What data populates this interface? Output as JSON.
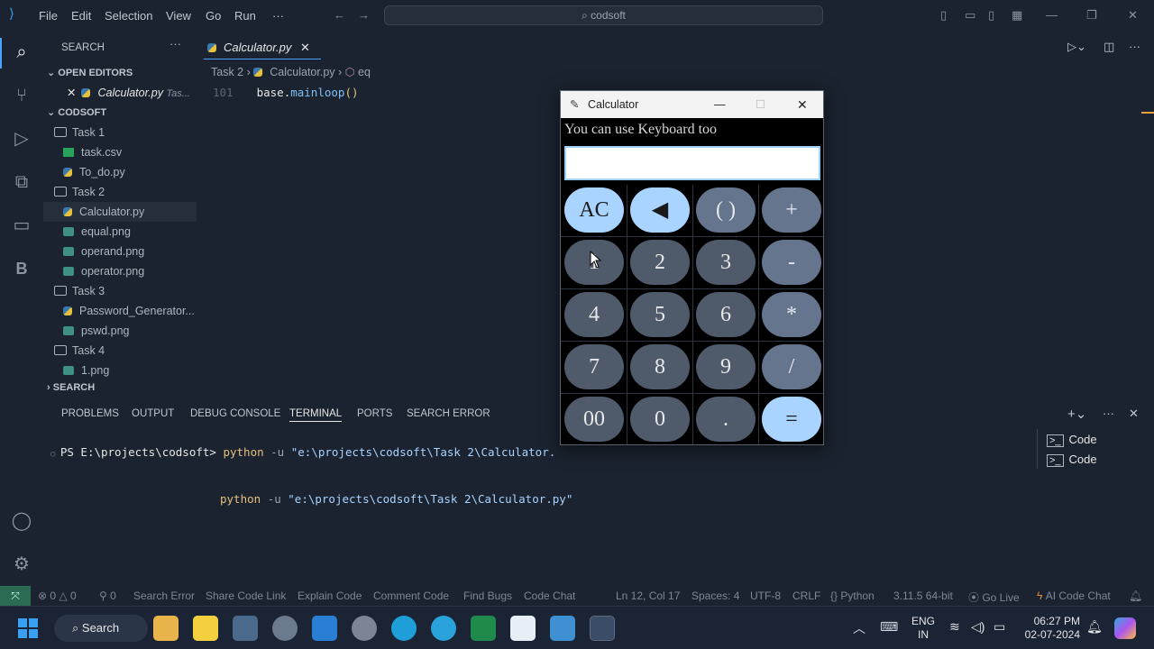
{
  "menu": {
    "file": "File",
    "edit": "Edit",
    "selection": "Selection",
    "view": "View",
    "go": "Go",
    "run": "Run",
    "more": "···"
  },
  "search_box": "codsoft",
  "sidebar": {
    "header": "SEARCH",
    "open_editors_label": "OPEN EDITORS",
    "open_editor_file": "Calculator.py",
    "open_editor_folder": "Tas...",
    "project_label": "CODSOFT",
    "items": [
      {
        "label": "Task 1",
        "kind": "folder"
      },
      {
        "label": "task.csv",
        "kind": "csv"
      },
      {
        "label": "To_do.py",
        "kind": "py"
      },
      {
        "label": "Task 2",
        "kind": "folder"
      },
      {
        "label": "Calculator.py",
        "kind": "py"
      },
      {
        "label": "equal.png",
        "kind": "png"
      },
      {
        "label": "operand.png",
        "kind": "png"
      },
      {
        "label": "operator.png",
        "kind": "png"
      },
      {
        "label": "Task 3",
        "kind": "folder"
      },
      {
        "label": "Password_Generator...",
        "kind": "py"
      },
      {
        "label": "pswd.png",
        "kind": "png"
      },
      {
        "label": "Task 4",
        "kind": "folder"
      },
      {
        "label": "1.png",
        "kind": "png"
      }
    ],
    "search_section": "SEARCH"
  },
  "editor": {
    "tab_label": "Calculator.py",
    "breadcrumb": {
      "folder": "Task 2",
      "file": "Calculator.py",
      "symbol": "eq"
    },
    "line_number": "101",
    "code_obj": "base",
    "code_method": "mainloop",
    "code_parens": "()"
  },
  "panel": {
    "tabs": [
      "PROBLEMS",
      "OUTPUT",
      "DEBUG CONSOLE",
      "TERMINAL",
      "PORTS",
      "SEARCH ERROR"
    ],
    "terminal_prompt": "PS E:\\projects\\codsoft>",
    "cmd_python": "python",
    "cmd_flag": "-u",
    "cmd_arg1": "\"e:\\projects\\codsoft\\Task 2\\Calculator.",
    "cmd_arg2": "\"e:\\projects\\codsoft\\Task 2\\Calculator.py\"",
    "terminals": [
      "Code",
      "Code"
    ]
  },
  "calculator": {
    "title": "Calculator",
    "hint": "You can use Keyboard too",
    "display_value": "",
    "rows": [
      [
        "AC",
        "◀",
        "( )",
        "+"
      ],
      [
        "1",
        "2",
        "3",
        "-"
      ],
      [
        "4",
        "5",
        "6",
        "*"
      ],
      [
        "7",
        "8",
        "9",
        "/"
      ],
      [
        "00",
        "0",
        ".",
        "="
      ]
    ]
  },
  "statusbar": {
    "errors": "0",
    "warnings": "0",
    "ports": "0",
    "search_error": "Search Error",
    "share_code_link": "Share Code Link",
    "explain_code": "Explain Code",
    "comment_code": "Comment Code",
    "find_bugs": "Find Bugs",
    "code_chat": "Code Chat",
    "position": "Ln 12, Col 17",
    "spaces": "Spaces: 4",
    "encoding": "UTF-8",
    "eol": "CRLF",
    "language": "Python",
    "interpreter": "3.11.5 64-bit",
    "go_live": "Go Live",
    "ai_chat": "AI Code Chat"
  },
  "taskbar": {
    "search_label": "Search",
    "lang_top": "ENG",
    "lang_bottom": "IN",
    "time": "06:27 PM",
    "date": "02-07-2024"
  },
  "colors": {
    "accent": "#4aa3ff",
    "key_light": "#a9d4ff",
    "key_dark": "#4f5a6a",
    "string": "#e5c07b"
  }
}
